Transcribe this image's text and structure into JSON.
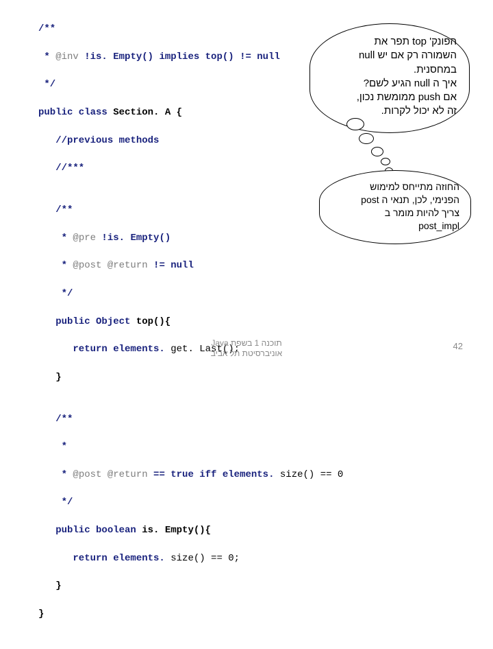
{
  "code": {
    "l01a": "/**",
    "l02a": " * ",
    "l02b": "@inv",
    "l02c": " !is. Empty() implies top() != null",
    "l03a": " */",
    "l04a": "public class ",
    "l04b": "Section. A {",
    "l05a": "   //previous methods",
    "l06a": "   //***",
    "l07a": "",
    "l08a": "   /**",
    "l09a": "    * ",
    "l09b": "@pre",
    "l09c": " !is. Empty()",
    "l10a": "    * ",
    "l10b": "@post @return",
    "l10c": " != null",
    "l11a": "    */",
    "l12a": "   public Object ",
    "l12b": "top(){",
    "l13a": "      return elements.",
    "l13b": " get. Last();",
    "l14a": "   }",
    "l15a": "",
    "l16a": "   /**",
    "l17a": "    *",
    "l18a": "    * ",
    "l18b": "@post @return",
    "l18c": " == true iff ",
    "l18d": "elements.",
    "l18e": " size() == 0",
    "l19a": "    */",
    "l20a": "   public boolean ",
    "l20b": "is. Empty(){",
    "l21a": "      return elements.",
    "l21b": " size() == 0;",
    "l22a": "   }",
    "l23a": "}"
  },
  "thought1": {
    "t1": "הפונק' top תפר את",
    "t2": "השמורה רק אם יש null",
    "t3": "במחסנית.",
    "t4": "איך ה null הגיע לשם?",
    "t5": "אם push ממומשת נכון,",
    "t6": "זה לא יכול לקרות."
  },
  "thought2": {
    "t1": "החוזה מתייחס למימוש",
    "t2": "הפנימי, לכן, תנאי ה post",
    "t3": "צריך להיות מומר ב",
    "t4": "post_impl"
  },
  "footer": {
    "center1": "תוכנה 1 בשפת Java",
    "center2": "אוניברסיטת תל אביב",
    "page": "42"
  }
}
